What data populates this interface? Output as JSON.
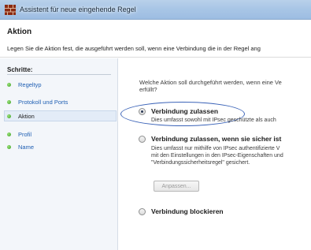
{
  "window": {
    "title": "Assistent für neue eingehende Regel"
  },
  "header": {
    "title": "Aktion",
    "description": "Legen Sie die Aktion fest, die ausgeführt werden soll, wenn eine Verbindung die in der Regel ang"
  },
  "sidebar": {
    "heading": "Schritte:",
    "items": [
      {
        "label": "Regeltyp",
        "current": false
      },
      {
        "label": "Protokoll und Ports",
        "current": false
      },
      {
        "label": "Aktion",
        "current": true
      },
      {
        "label": "Profil",
        "current": false
      },
      {
        "label": "Name",
        "current": false
      }
    ]
  },
  "main": {
    "question_line1": "Welche Aktion soll durchgeführt werden, wenn eine Ve",
    "question_line2": "erfüllt?",
    "options": [
      {
        "label": "Verbindung zulassen",
        "selected": true,
        "desc": [
          "Dies umfasst sowohl mit IPsec geschützte als auch"
        ]
      },
      {
        "label": "Verbindung zulassen, wenn sie sicher ist",
        "selected": false,
        "desc": [
          "Dies umfasst nur mithilfe von IPsec authentifizierte V",
          "mit den Einstellungen in den IPsec-Eigenschaften und",
          "\"Verbindungssicherheitsregel\" gesichert."
        ]
      },
      {
        "label": "Verbindung blockieren",
        "selected": false,
        "desc": []
      }
    ],
    "customize_button": "Anpassen...",
    "colors": {
      "highlight_ellipse": "#3b63b8",
      "link": "#1f5fb3",
      "step_dot": "#3a9e22"
    }
  },
  "icons": {
    "app": "firewall-wall-icon",
    "step": "green-dot-icon"
  }
}
